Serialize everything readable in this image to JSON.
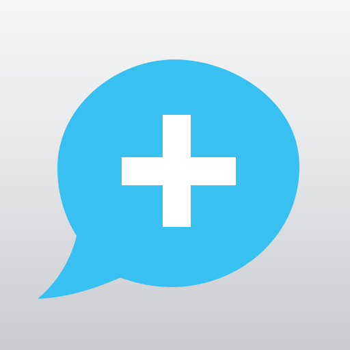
{
  "app_icon": {
    "icon": "speech-bubble-plus-icon",
    "colors": {
      "background_top": "#f6f6f6",
      "background_bottom": "#c9cbcf",
      "bubble": "#38c1f0",
      "plus": "#ffffff"
    }
  }
}
